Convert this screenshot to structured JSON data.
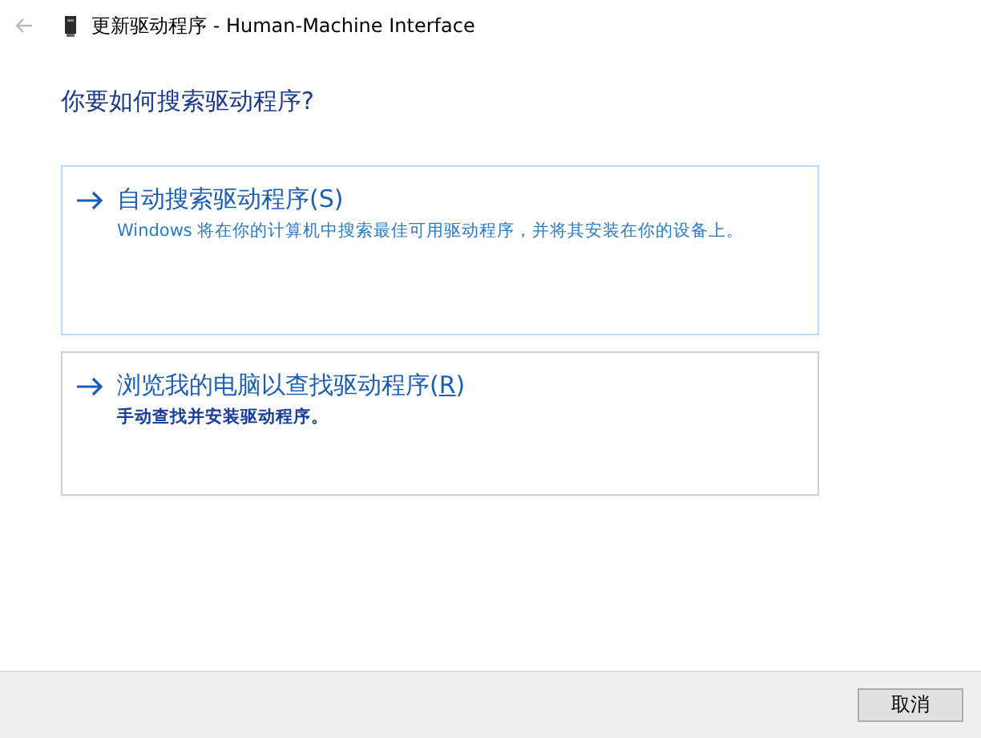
{
  "window": {
    "title": "更新驱动程序 - Human-Machine Interface"
  },
  "heading": "你要如何搜索驱动程序?",
  "options": [
    {
      "label_before": "自动搜索驱动程序(",
      "access_key": "S",
      "label_after": ")",
      "access_key_underlined": false,
      "description": "Windows 将在你的计算机中搜索最佳可用驱动程序，并将其安装在你的设备上。",
      "selected": true
    },
    {
      "label_before": "浏览我的电脑以查找驱动程序(",
      "access_key": "R",
      "label_after": ")",
      "access_key_underlined": true,
      "description": "手动查找并安装驱动程序。",
      "selected": false
    }
  ],
  "buttons": [
    "取消"
  ]
}
